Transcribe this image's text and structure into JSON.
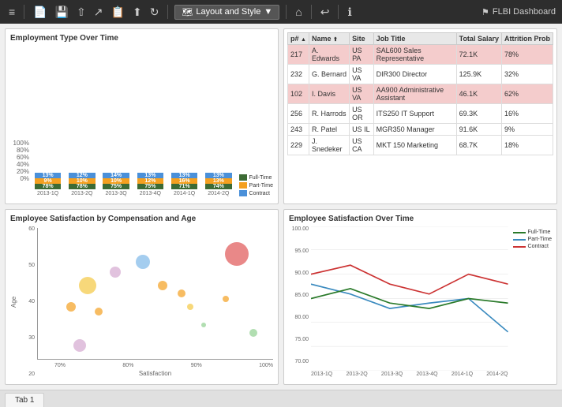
{
  "toolbar": {
    "title": "Layout and Style",
    "dashboard_title": "FLBI Dashboard",
    "dropdown_arrow": "▼",
    "icons": [
      "≡",
      "💾",
      "↩",
      "↪",
      "📋",
      "⬆",
      "↻",
      "🗺",
      "↩",
      "ℹ"
    ]
  },
  "bar_chart": {
    "title": "Employment Type Over Time",
    "y_labels": [
      "100%",
      "80%",
      "60%",
      "40%",
      "20%",
      "0%"
    ],
    "x_labels": [
      "2013-1Q",
      "2013-2Q",
      "2013-3Q",
      "2013-4Q",
      "2014-1Q",
      "2014-2Q"
    ],
    "legend": [
      {
        "label": "Full-Time",
        "color": "#3d6b35"
      },
      {
        "label": "Part-Time",
        "color": "#f4a020"
      },
      {
        "label": "Contract",
        "color": "#4a90d9"
      }
    ],
    "bars": [
      {
        "fulltime": 78,
        "parttime": 9,
        "contract": 13
      },
      {
        "fulltime": 78,
        "parttime": 10,
        "contract": 12
      },
      {
        "fulltime": 75,
        "parttime": 10,
        "contract": 14
      },
      {
        "fulltime": 75,
        "parttime": 12,
        "contract": 13
      },
      {
        "fulltime": 71,
        "parttime": 16,
        "contract": 13
      },
      {
        "fulltime": 74,
        "parttime": 13,
        "contract": 13
      }
    ]
  },
  "table": {
    "columns": [
      "p#",
      "Name",
      "Site",
      "Job Title",
      "Total Salary",
      "Attrition Prob"
    ],
    "rows": [
      {
        "id": "217",
        "name": "A. Edwards",
        "site": "US PA",
        "job": "SAL600 Sales Representative",
        "salary": "72.1K",
        "attrition": "78%",
        "highlight": true
      },
      {
        "id": "232",
        "name": "G. Bernard",
        "site": "US VA",
        "job": "DIR300 Director",
        "salary": "125.9K",
        "attrition": "32%",
        "highlight": false
      },
      {
        "id": "102",
        "name": "I. Davis",
        "site": "US VA",
        "job": "AA900 Administrative Assistant",
        "salary": "46.1K",
        "attrition": "62%",
        "highlight": true
      },
      {
        "id": "256",
        "name": "R. Harrods",
        "site": "US OR",
        "job": "ITS250 IT Support",
        "salary": "69.3K",
        "attrition": "16%",
        "highlight": false
      },
      {
        "id": "243",
        "name": "R. Patel",
        "site": "US IL",
        "job": "MGR350 Manager",
        "salary": "91.6K",
        "attrition": "9%",
        "highlight": false
      },
      {
        "id": "229",
        "name": "J. Snedeker",
        "site": "US CA",
        "job": "MKT 150 Marketing",
        "salary": "68.7K",
        "attrition": "18%",
        "highlight": false
      }
    ]
  },
  "scatter": {
    "title": "Employee Satisfaction by Compensation and Age",
    "x_label": "Satisfaction",
    "y_label": "Age",
    "x_ticks": [
      "70%",
      "80%",
      "90%",
      "100%"
    ],
    "y_ticks": [
      "60",
      "50",
      "40",
      "30",
      "20"
    ],
    "bubbles": [
      {
        "x": 15,
        "y": 20,
        "r": 16,
        "color": "#d4a8d0"
      },
      {
        "x": 12,
        "y": 35,
        "r": 12,
        "color": "#f4a020"
      },
      {
        "x": 22,
        "y": 33,
        "r": 10,
        "color": "#f4a020"
      },
      {
        "x": 18,
        "y": 43,
        "r": 22,
        "color": "#f4c842"
      },
      {
        "x": 28,
        "y": 48,
        "r": 14,
        "color": "#d4a8d0"
      },
      {
        "x": 38,
        "y": 52,
        "r": 18,
        "color": "#7db8e8"
      },
      {
        "x": 45,
        "y": 43,
        "r": 12,
        "color": "#f4a020"
      },
      {
        "x": 52,
        "y": 40,
        "r": 10,
        "color": "#f4a020"
      },
      {
        "x": 55,
        "y": 35,
        "r": 8,
        "color": "#f4c842"
      },
      {
        "x": 60,
        "y": 28,
        "r": 6,
        "color": "#90d090"
      },
      {
        "x": 72,
        "y": 55,
        "r": 30,
        "color": "#e05555"
      },
      {
        "x": 68,
        "y": 38,
        "r": 8,
        "color": "#f4a020"
      },
      {
        "x": 78,
        "y": 25,
        "r": 10,
        "color": "#90d090"
      }
    ]
  },
  "line_chart": {
    "title": "Employee Satisfaction Over Time",
    "y_ticks": [
      "100.00",
      "95.00",
      "90.00",
      "85.00",
      "80.00",
      "75.00",
      "70.00"
    ],
    "x_labels": [
      "2013-1Q",
      "2013-2Q",
      "2013-3Q",
      "2013-4Q",
      "2014-1Q",
      "2014-2Q"
    ],
    "legend": [
      {
        "label": "Full-Time",
        "color": "#2a7a2a"
      },
      {
        "label": "Part-Time",
        "color": "#3a8abf"
      },
      {
        "label": "Contract",
        "color": "#cc3333"
      }
    ],
    "series": {
      "fulltime": [
        85,
        87,
        84,
        83,
        85,
        84
      ],
      "parttime": [
        88,
        86,
        83,
        84,
        85,
        79
      ],
      "contract": [
        90,
        92,
        88,
        86,
        90,
        88
      ]
    }
  },
  "tabs": [
    {
      "label": "Tab 1"
    }
  ]
}
